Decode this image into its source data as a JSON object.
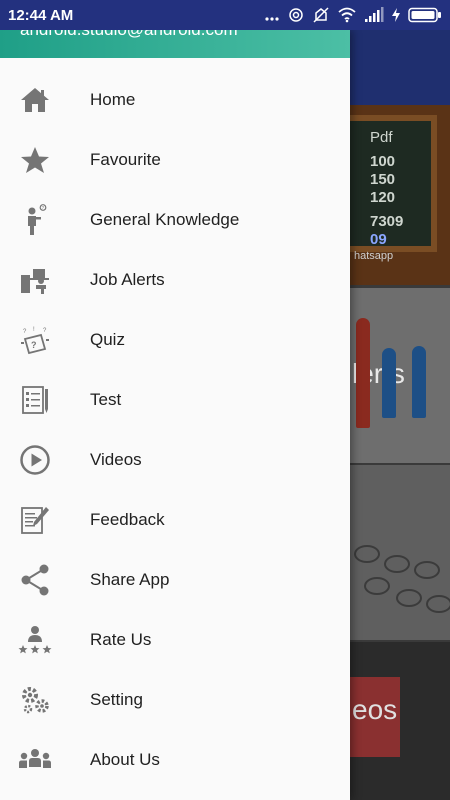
{
  "status_bar": {
    "time": "12:44 AM",
    "icons": [
      "more-dots-icon",
      "hotspot-icon",
      "data-off-icon",
      "wifi-icon",
      "signal-icon",
      "charging-icon",
      "battery-icon"
    ]
  },
  "drawer": {
    "header": {
      "email": "android.studio@android.com",
      "gradient": [
        "#1f9f87",
        "#4cbfa5"
      ]
    },
    "items": [
      {
        "label": "Home",
        "icon": "home-icon"
      },
      {
        "label": "Favourite",
        "icon": "star-icon"
      },
      {
        "label": "General Knowledge",
        "icon": "thinking-person-icon"
      },
      {
        "label": "Job Alerts",
        "icon": "person-at-desk-icon"
      },
      {
        "label": "Quiz",
        "icon": "quiz-icon"
      },
      {
        "label": "Test",
        "icon": "checklist-icon"
      },
      {
        "label": "Videos",
        "icon": "play-circle-icon"
      },
      {
        "label": "Feedback",
        "icon": "edit-document-icon"
      },
      {
        "label": "Share App",
        "icon": "share-icon"
      },
      {
        "label": "Rate Us",
        "icon": "rating-person-icon"
      },
      {
        "label": "Setting",
        "icon": "gears-icon"
      },
      {
        "label": "About Us",
        "icon": "group-icon"
      }
    ]
  },
  "background": {
    "card1_lines": [
      "Pdf",
      "100",
      "150",
      "120",
      "7309",
      "09",
      "hatsapp"
    ],
    "card2_text": "lerts",
    "card4_text": "eos"
  },
  "colors": {
    "status_bar": "#23317f",
    "icon_gray": "#757575",
    "text": "#212121"
  }
}
